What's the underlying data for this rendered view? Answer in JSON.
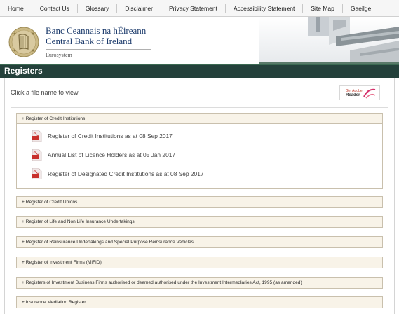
{
  "nav": {
    "items": [
      "Home",
      "Contact Us",
      "Glossary",
      "Disclaimer",
      "Privacy Statement",
      "Accessibility Statement",
      "Site Map",
      "Gaeilge"
    ]
  },
  "header": {
    "name_irish": "Banc Ceannais na hÉireann",
    "name_english": "Central Bank of Ireland",
    "tagline": "Eurosystem"
  },
  "page": {
    "title": "Registers",
    "intro": "Click a file name to view",
    "reader_small": "Get Adobe",
    "reader_big": "Reader"
  },
  "sections": [
    {
      "label": "+ Register of Credit Institutions",
      "expanded": true,
      "files": [
        "Register of Credit Institutions as at 08 Sep 2017",
        "Annual List of Licence Holders as at 05 Jan 2017",
        "Register of Designated Credit Institutions as at 08 Sep 2017"
      ]
    },
    {
      "label": "+ Register of Credit Unions",
      "expanded": false
    },
    {
      "label": "+ Register of Life and Non Life Insurance Undertakings",
      "expanded": false
    },
    {
      "label": "+ Register of Reinsurance Undertakings and Special Purpose Reinsurance Vehicles",
      "expanded": false
    },
    {
      "label": "+ Register of Investment Firms (MiFID)",
      "expanded": false
    },
    {
      "label": "+ Registers of Investment Business Firms authorised or deemed authorised under the Investment Intermediaries Act, 1995 (as amended)",
      "expanded": false
    },
    {
      "label": "+ Insurance Mediation Register",
      "expanded": false
    }
  ],
  "colors": {
    "titlebar": "#24413b",
    "panel_bg": "#f8f3e8",
    "panel_border": "#c9c0ad",
    "pdf_red": "#c8302c"
  }
}
